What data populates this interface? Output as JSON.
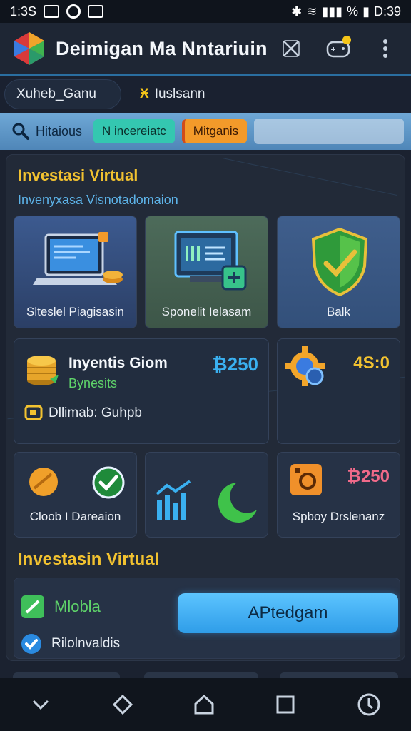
{
  "status_bar": {
    "time_left": "1:3S",
    "time_right": "D:39",
    "battery_label": "%"
  },
  "app": {
    "title": "Deimigan Ma Nntariuin"
  },
  "tabs": [
    {
      "label": "Xuheb_Ganu",
      "icon": ""
    },
    {
      "label": "Iuslsann",
      "icon": "Ӿ"
    }
  ],
  "filters": {
    "search_label": "Hitaious",
    "chips": [
      "N incereiatc",
      "Mitganis"
    ]
  },
  "section1": {
    "title": "Investasi Virtual",
    "subtitle": "Invenyxasa Visnotadomaion"
  },
  "cards_row1": [
    {
      "label": "Slteslel Piagisasin",
      "icon": "laptop-coin-icon"
    },
    {
      "label": "Sponelit Ielasam",
      "icon": "monitor-chart-icon"
    },
    {
      "label": "Balk",
      "icon": "shield-check-icon"
    }
  ],
  "invest_card": {
    "title": "Inyentis Giom",
    "subtitle": "Bynesits",
    "amount": "₿250",
    "footer": "Dllimab: Guhpb"
  },
  "gear_card": {
    "value": "4S:0"
  },
  "cards_row3": [
    {
      "label": "Cloob I Dareaion"
    },
    {
      "label": ""
    },
    {
      "label": "Spboy Drslenanz",
      "value": "₿250"
    }
  ],
  "section2": {
    "title": "Investasin Virtual",
    "option1": "Mlobla",
    "option2": "Rilolnvaldis",
    "button": "APtedgam"
  },
  "colors": {
    "accent_gold": "#f2c230",
    "accent_blue": "#3aa8f0",
    "background": "#1b2230"
  },
  "nav": [
    "chevron-down-icon",
    "diamond-icon",
    "home-icon",
    "square-icon",
    "compass-icon"
  ]
}
